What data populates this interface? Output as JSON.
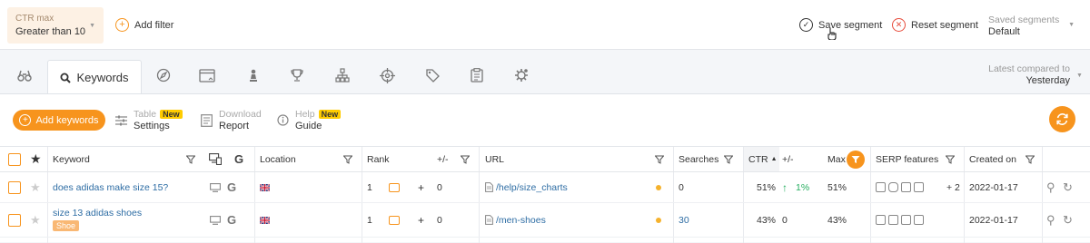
{
  "filterbar": {
    "ctr_filter": {
      "label": "CTR max",
      "value": "Greater than 10"
    },
    "add_filter": "Add filter",
    "save_segment": "Save segment",
    "reset_segment": "Reset segment",
    "saved_segments": {
      "label": "Saved segments",
      "value": "Default"
    }
  },
  "tabs": {
    "active_label": "Keywords",
    "icons": [
      "binoculars-icon",
      "compass-icon",
      "browser-icon",
      "chess-pawn-icon",
      "trophy-icon",
      "sitemap-icon",
      "crosshair-icon",
      "tag-icon",
      "clipboard-icon",
      "gear-badge-icon"
    ]
  },
  "compared": {
    "label": "Latest compared to",
    "value": "Yesterday"
  },
  "toolbar": {
    "add_keywords": "Add keywords",
    "table_settings": {
      "line1": "Table",
      "line2": "Settings",
      "badge": "New"
    },
    "download_report": {
      "line1": "Download",
      "line2": "Report"
    },
    "help_guide": {
      "line1": "Help",
      "line2": "Guide",
      "badge": "New"
    }
  },
  "table": {
    "headers": {
      "keyword": "Keyword",
      "location": "Location",
      "rank": "Rank",
      "rank_change": "+/-",
      "url": "URL",
      "searches": "Searches",
      "ctr": "CTR",
      "ctr_change": "+/-",
      "max": "Max",
      "serp_features": "SERP features",
      "created_on": "Created on"
    },
    "rows": [
      {
        "keyword": "does adidas make size 15?",
        "tag": "",
        "rank": "1",
        "rank_change": "0",
        "url": "/help/size_charts",
        "searches": "0",
        "ctr": "51%",
        "ctr_change": "1%",
        "max": "51%",
        "serp_extra": "+ 2",
        "created_on": "2022-01-17"
      },
      {
        "keyword": "size 13 adidas shoes",
        "tag": "Shoe",
        "rank": "1",
        "rank_change": "0",
        "url": "/men-shoes",
        "searches": "30",
        "ctr": "43%",
        "ctr_change": "0",
        "max": "43%",
        "serp_extra": "",
        "created_on": "2022-01-17"
      }
    ]
  },
  "colors": {
    "accent": "#f7941d",
    "link": "#2e6da4",
    "positive": "#27ae60"
  }
}
